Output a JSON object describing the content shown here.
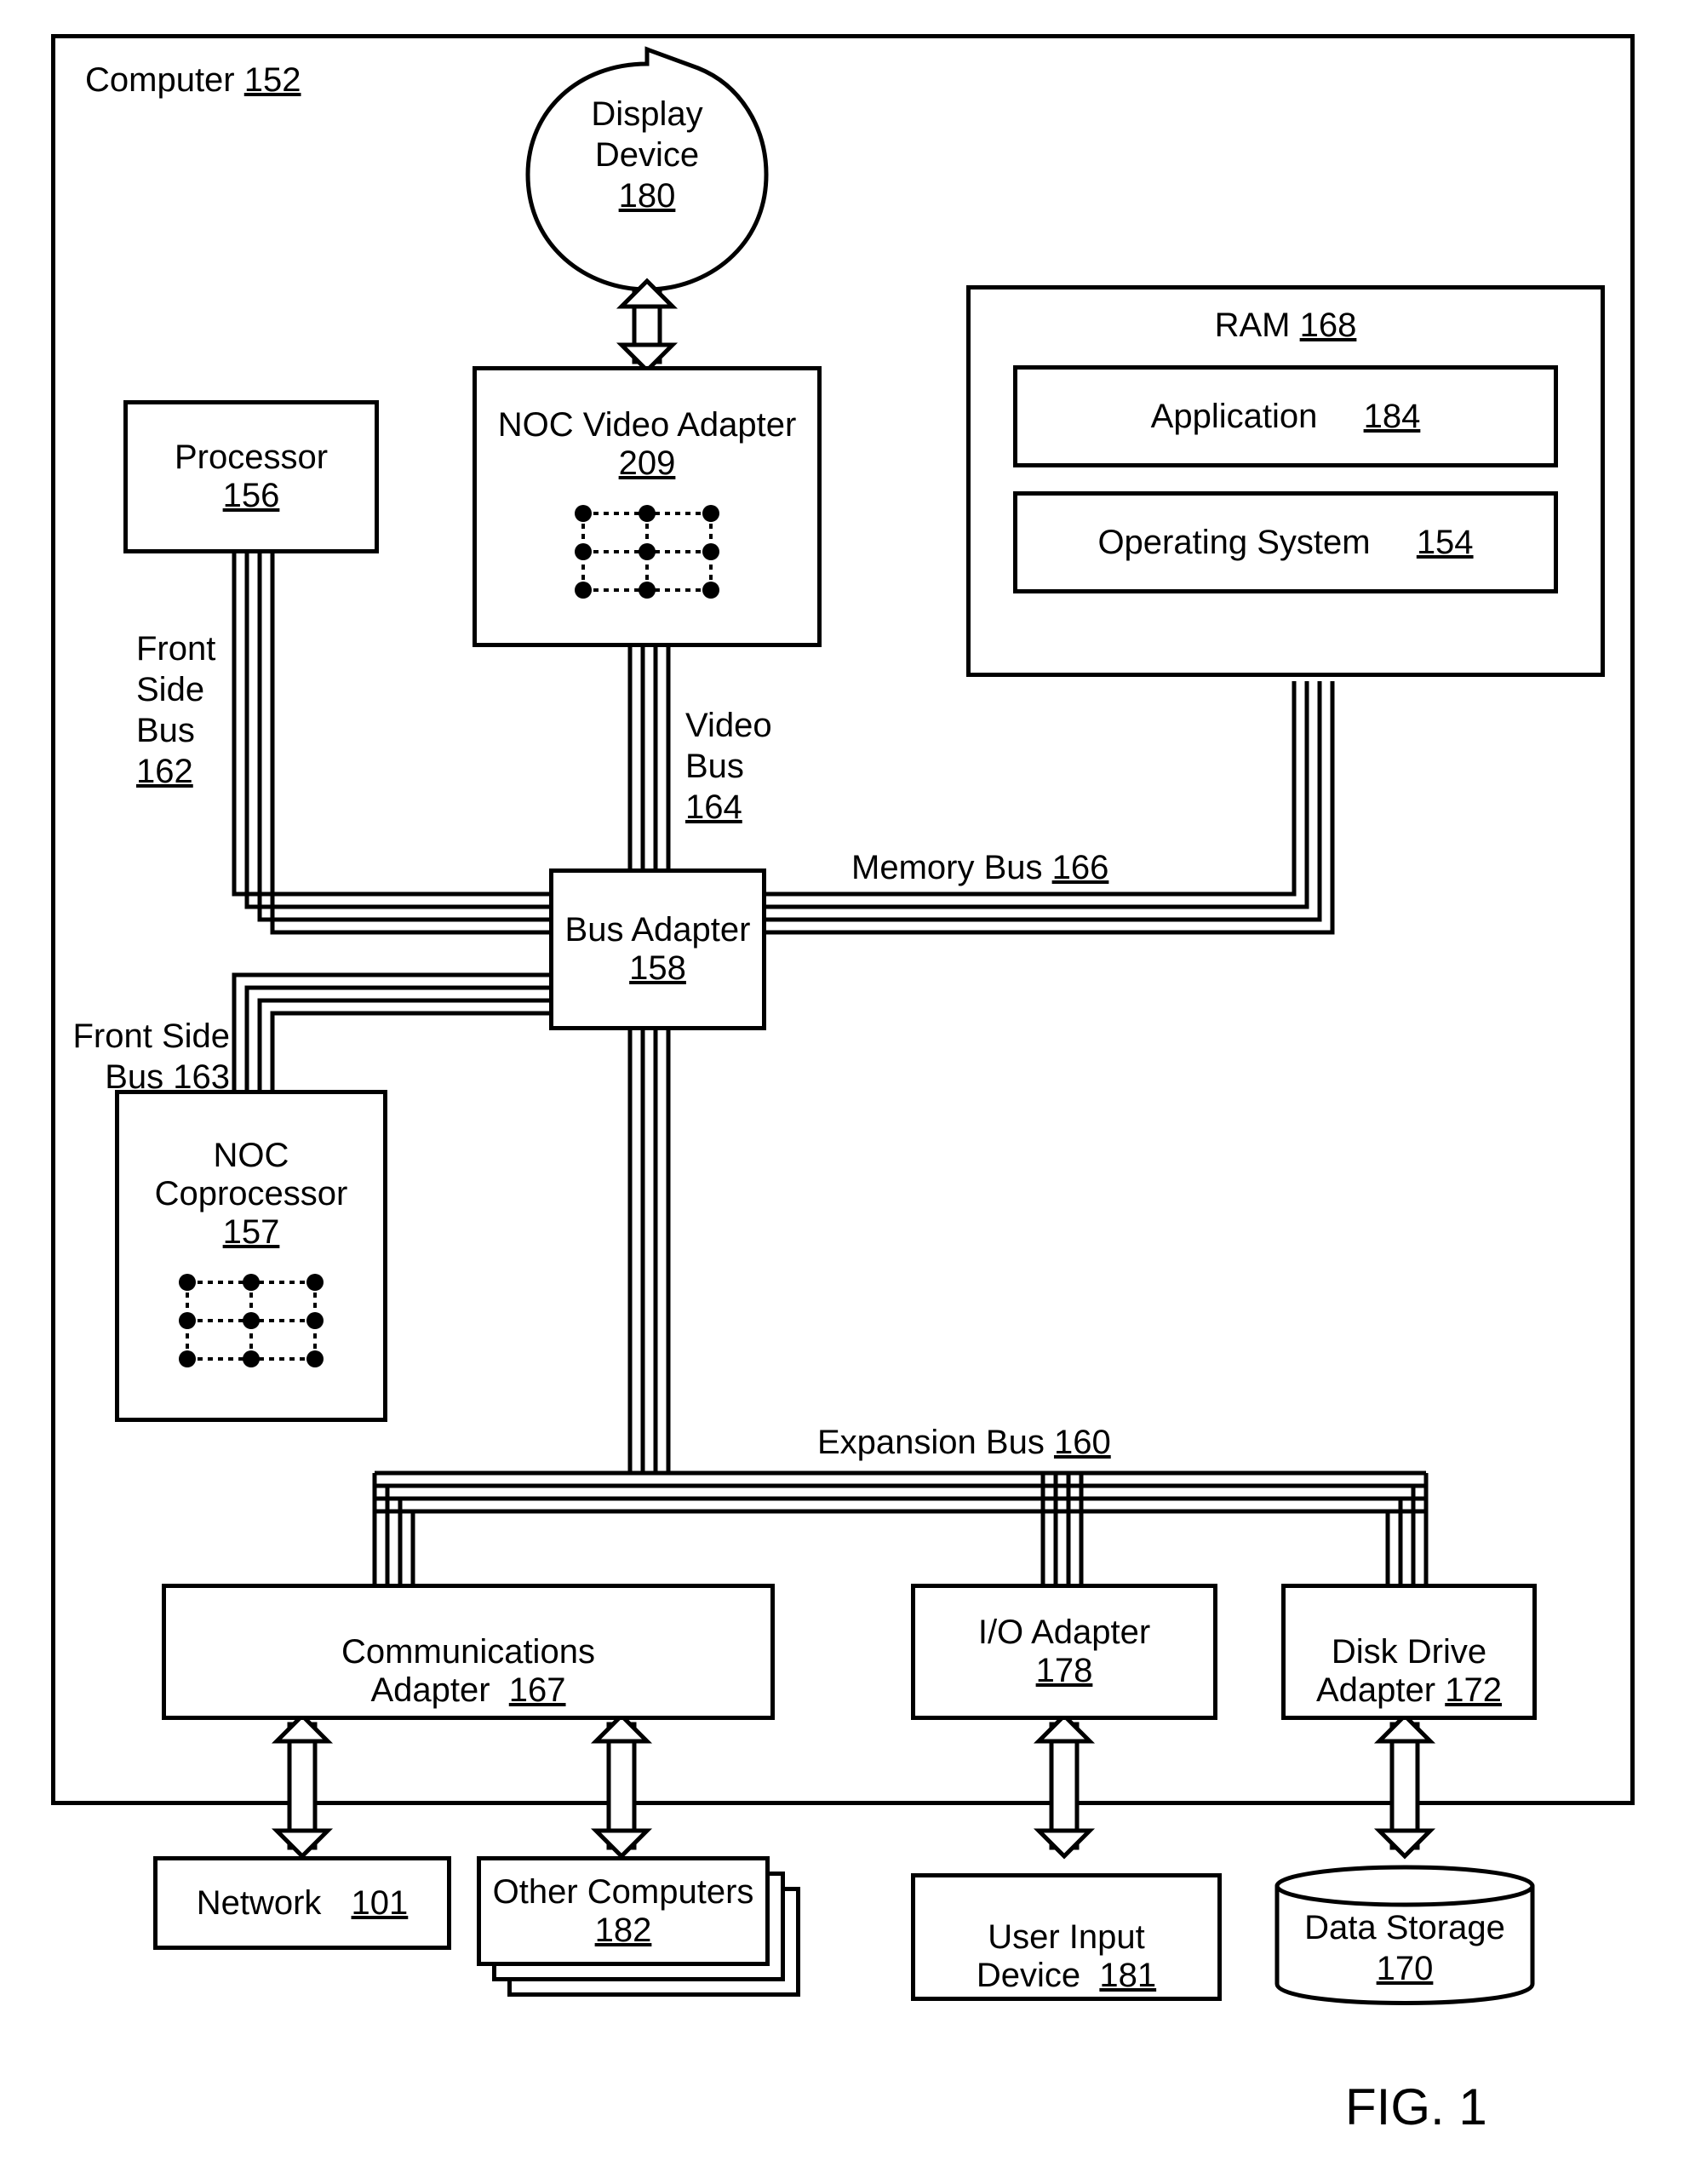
{
  "figure_label": "FIG. 1",
  "computer": {
    "label": "Computer",
    "ref": "152"
  },
  "display_device": {
    "label": "Display\nDevice",
    "ref": "180"
  },
  "noc_video_adapter": {
    "label": "NOC Video Adapter",
    "ref": "209"
  },
  "processor": {
    "label": "Processor",
    "ref": "156"
  },
  "ram": {
    "label": "RAM",
    "ref": "168"
  },
  "application": {
    "label": "Application",
    "ref": "184"
  },
  "operating_system": {
    "label": "Operating System",
    "ref": "154"
  },
  "bus_adapter": {
    "label": "Bus Adapter",
    "ref": "158"
  },
  "noc_coprocessor": {
    "label": "NOC\nCoprocessor",
    "ref": "157"
  },
  "communications_adapter": {
    "label": "Communications\nAdapter",
    "ref": "167"
  },
  "io_adapter": {
    "label": "I/O Adapter",
    "ref": "178"
  },
  "disk_drive_adapter": {
    "label": "Disk Drive\nAdapter",
    "ref": "172"
  },
  "network": {
    "label": "Network",
    "ref": "101"
  },
  "other_computers": {
    "label": "Other Computers",
    "ref": "182"
  },
  "user_input_device": {
    "label": "User Input\nDevice",
    "ref": "181"
  },
  "data_storage": {
    "label": "Data Storage",
    "ref": "170"
  },
  "buses": {
    "front_side_bus_162": {
      "label": "Front\nSide\nBus",
      "ref": "162"
    },
    "video_bus_164": {
      "label": "Video\nBus",
      "ref": "164"
    },
    "memory_bus_166": {
      "label": "Memory Bus",
      "ref": "166"
    },
    "front_side_bus_163": {
      "label": "Front Side\nBus",
      "ref": "163"
    },
    "expansion_bus_160": {
      "label": "Expansion Bus",
      "ref": "160"
    }
  }
}
